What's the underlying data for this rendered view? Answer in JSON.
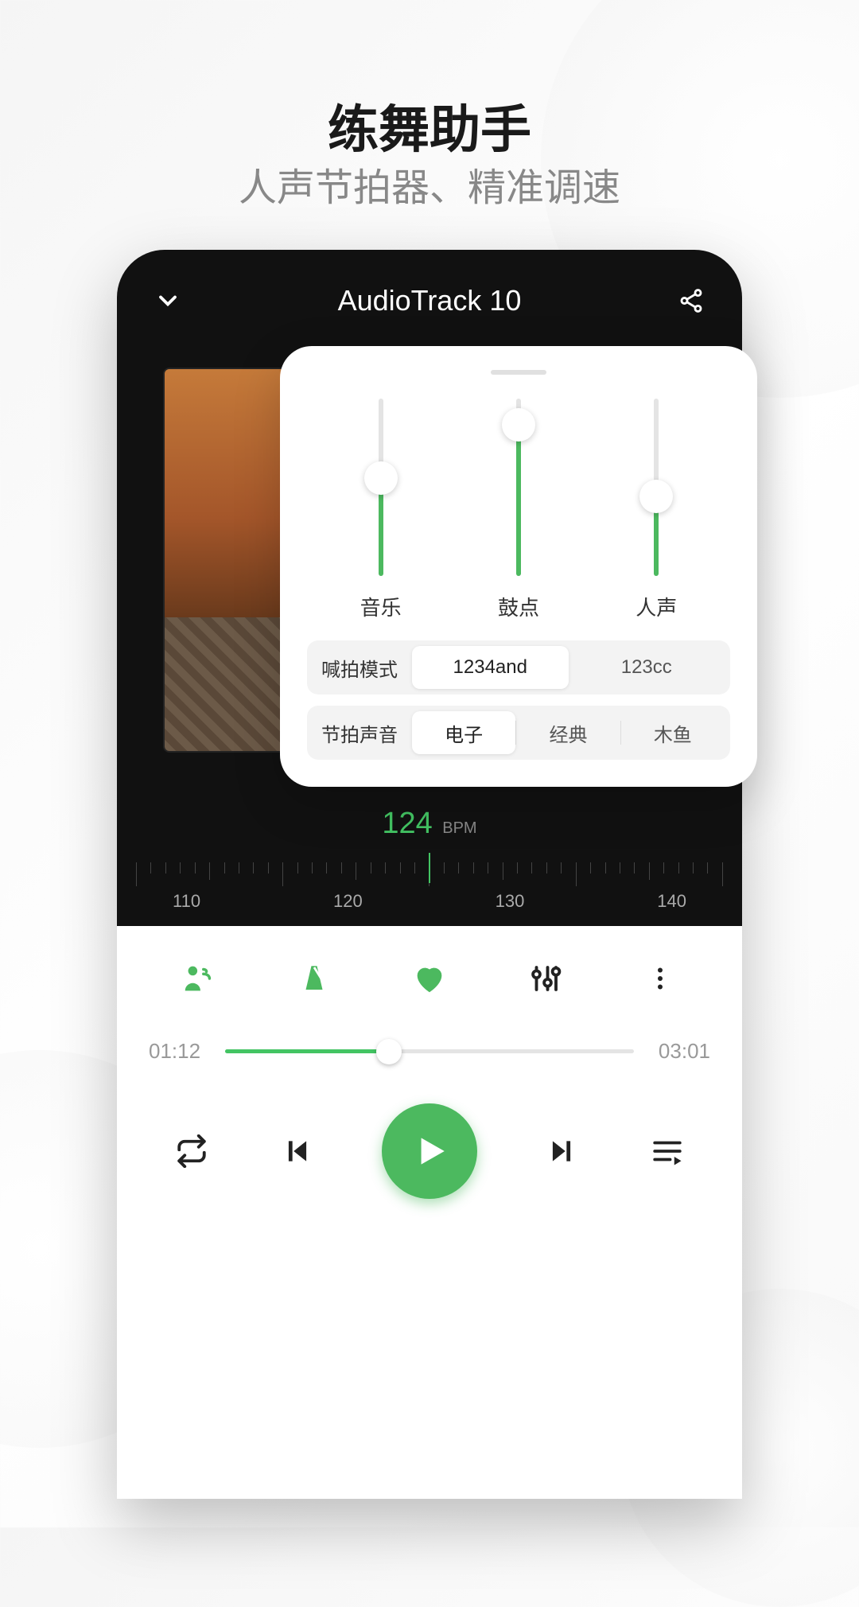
{
  "promo": {
    "title": "练舞助手",
    "subtitle": "人声节拍器、精准调速"
  },
  "accent_color": "#4cb95f",
  "player": {
    "track_title": "AudioTrack 10",
    "bpm_value": "124",
    "bpm_unit": "BPM",
    "ruler_labels": [
      "110",
      "120",
      "130",
      "140"
    ],
    "time_elapsed": "01:12",
    "time_total": "03:01",
    "progress_percent": 40
  },
  "popover": {
    "sliders": [
      {
        "label": "音乐",
        "percent": 55
      },
      {
        "label": "鼓点",
        "percent": 85
      },
      {
        "label": "人声",
        "percent": 45
      }
    ],
    "mode": {
      "label": "喊拍模式",
      "options": [
        "1234and",
        "123cc"
      ],
      "selected": 0
    },
    "sound": {
      "label": "节拍声音",
      "options": [
        "电子",
        "经典",
        "木鱼"
      ],
      "selected": 0
    }
  }
}
